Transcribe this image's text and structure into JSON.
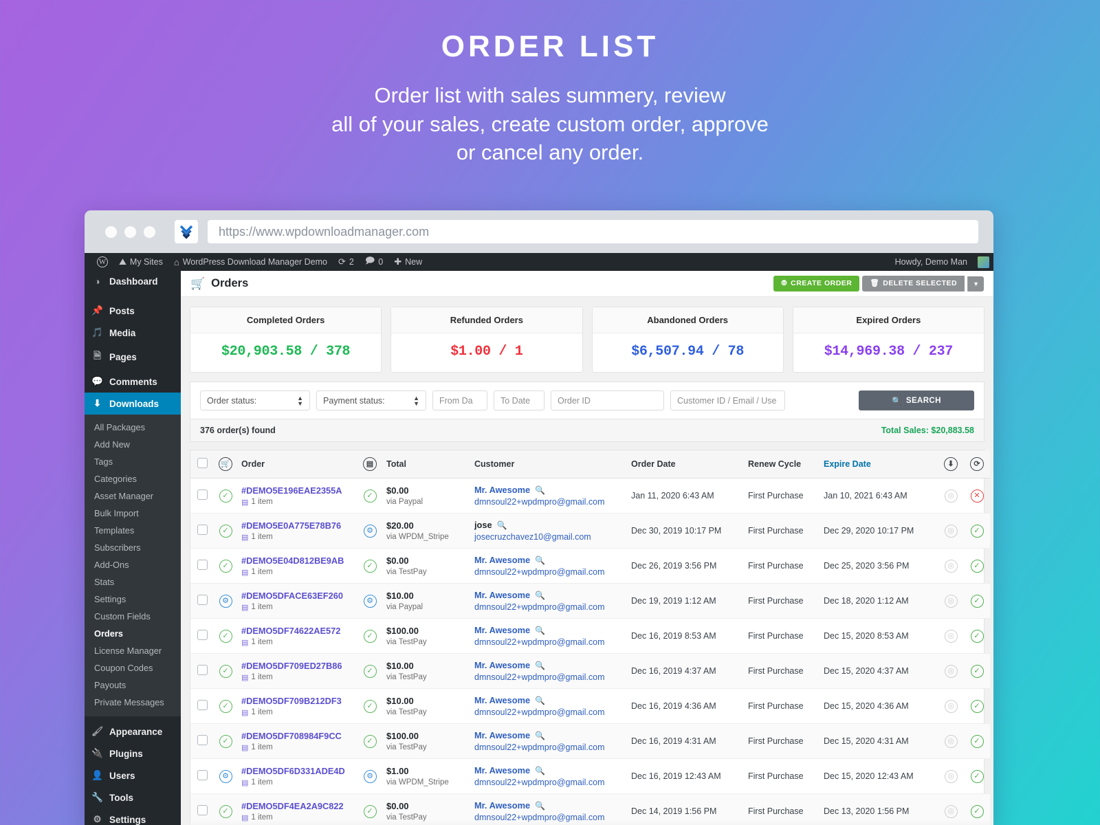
{
  "promo": {
    "title": "ORDER LIST",
    "subtitle_lines": [
      "Order list with sales summery, review",
      "all of your sales, create custom order, approve",
      "or cancel any order."
    ]
  },
  "browser": {
    "url": "https://www.wpdownloadmanager.com"
  },
  "wpbar": {
    "my_sites": "My Sites",
    "site_name": "WordPress Download Manager Demo",
    "updates_count": "2",
    "comments_count": "0",
    "new_label": "New",
    "howdy": "Howdy, Demo Man"
  },
  "sidebar": {
    "main": [
      {
        "label": "Dashboard",
        "icon": "dashboard-icon"
      },
      {
        "label": "Posts",
        "icon": "pin-icon"
      },
      {
        "label": "Media",
        "icon": "media-icon"
      },
      {
        "label": "Pages",
        "icon": "pages-icon"
      },
      {
        "label": "Comments",
        "icon": "comment-icon"
      },
      {
        "label": "Downloads",
        "icon": "download-icon"
      }
    ],
    "submenu": [
      "All Packages",
      "Add New",
      "Tags",
      "Categories",
      "Asset Manager",
      "Bulk Import",
      "Templates",
      "Subscribers",
      "Add-Ons",
      "Stats",
      "Settings",
      "Custom Fields",
      "Orders",
      "License Manager",
      "Coupon Codes",
      "Payouts",
      "Private Messages"
    ],
    "current_sub": "Orders",
    "bottom": [
      {
        "label": "Appearance",
        "icon": "brush-icon"
      },
      {
        "label": "Plugins",
        "icon": "plug-icon"
      },
      {
        "label": "Users",
        "icon": "user-icon"
      },
      {
        "label": "Tools",
        "icon": "wrench-icon"
      },
      {
        "label": "Settings",
        "icon": "settings-icon"
      }
    ]
  },
  "page": {
    "title": "Orders",
    "create_order": "CREATE ORDER",
    "delete_selected": "DELETE SELECTED"
  },
  "stats": [
    {
      "title": "Completed Orders",
      "value": "$20,903.58 / 378",
      "color": "#1db954"
    },
    {
      "title": "Refunded Orders",
      "value": "$1.00 / 1",
      "color": "#f0323c"
    },
    {
      "title": "Abandoned Orders",
      "value": "$6,507.94 / 78",
      "color": "#2f5fe0"
    },
    {
      "title": "Expired Orders",
      "value": "$14,969.38 / 237",
      "color": "#8a3ff0"
    }
  ],
  "filters": {
    "order_status": "Order status:",
    "payment_status": "Payment status:",
    "from_date_placeholder": "From Da",
    "to_date_placeholder": "To Date",
    "order_id_placeholder": "Order ID",
    "customer_placeholder": "Customer ID / Email / Use",
    "search_label": "SEARCH"
  },
  "summary": {
    "count_text": "376 order(s) found",
    "total_sales": "Total Sales: $20,883.58"
  },
  "table": {
    "headers": {
      "order": "Order",
      "total": "Total",
      "customer": "Customer",
      "order_date": "Order Date",
      "renew_cycle": "Renew Cycle",
      "expire_date": "Expire Date"
    },
    "rows": [
      {
        "order_status": "complete",
        "order_no": "#DEMO5E196EAE2355A",
        "items": "1 item",
        "pay_status": "complete",
        "total": "$0.00",
        "via": "via Paypal",
        "customer": "Mr. Awesome",
        "customer_link": true,
        "email": "dmnsoul22+wpdmpro@gmail.com",
        "order_date": "Jan 11, 2020 6:43 AM",
        "renew_cycle": "First Purchase",
        "expire_date": "Jan 10, 2021 6:43 AM",
        "action": "cancel"
      },
      {
        "order_status": "complete",
        "order_no": "#DEMO5E0A775E78B76",
        "items": "1 item",
        "pay_status": "pending",
        "total": "$20.00",
        "via": "via WPDM_Stripe",
        "customer": "jose",
        "customer_link": false,
        "email": "josecruzchavez10@gmail.com",
        "order_date": "Dec 30, 2019 10:17 PM",
        "renew_cycle": "First Purchase",
        "expire_date": "Dec 29, 2020 10:17 PM",
        "action": "approve"
      },
      {
        "order_status": "complete",
        "order_no": "#DEMO5E04D812BE9AB",
        "items": "1 item",
        "pay_status": "complete",
        "total": "$0.00",
        "via": "via TestPay",
        "customer": "Mr. Awesome",
        "customer_link": true,
        "email": "dmnsoul22+wpdmpro@gmail.com",
        "order_date": "Dec 26, 2019 3:56 PM",
        "renew_cycle": "First Purchase",
        "expire_date": "Dec 25, 2020 3:56 PM",
        "action": "approve"
      },
      {
        "order_status": "pending",
        "order_no": "#DEMO5DFACE63EF260",
        "items": "1 item",
        "pay_status": "pending",
        "total": "$10.00",
        "via": "via Paypal",
        "customer": "Mr. Awesome",
        "customer_link": true,
        "email": "dmnsoul22+wpdmpro@gmail.com",
        "order_date": "Dec 19, 2019 1:12 AM",
        "renew_cycle": "First Purchase",
        "expire_date": "Dec 18, 2020 1:12 AM",
        "action": "approve"
      },
      {
        "order_status": "complete",
        "order_no": "#DEMO5DF74622AE572",
        "items": "1 item",
        "pay_status": "complete",
        "total": "$100.00",
        "via": "via TestPay",
        "customer": "Mr. Awesome",
        "customer_link": true,
        "email": "dmnsoul22+wpdmpro@gmail.com",
        "order_date": "Dec 16, 2019 8:53 AM",
        "renew_cycle": "First Purchase",
        "expire_date": "Dec 15, 2020 8:53 AM",
        "action": "approve"
      },
      {
        "order_status": "complete",
        "order_no": "#DEMO5DF709ED27B86",
        "items": "1 item",
        "pay_status": "complete",
        "total": "$10.00",
        "via": "via TestPay",
        "customer": "Mr. Awesome",
        "customer_link": true,
        "email": "dmnsoul22+wpdmpro@gmail.com",
        "order_date": "Dec 16, 2019 4:37 AM",
        "renew_cycle": "First Purchase",
        "expire_date": "Dec 15, 2020 4:37 AM",
        "action": "approve"
      },
      {
        "order_status": "complete",
        "order_no": "#DEMO5DF709B212DF3",
        "items": "1 item",
        "pay_status": "complete",
        "total": "$10.00",
        "via": "via TestPay",
        "customer": "Mr. Awesome",
        "customer_link": true,
        "email": "dmnsoul22+wpdmpro@gmail.com",
        "order_date": "Dec 16, 2019 4:36 AM",
        "renew_cycle": "First Purchase",
        "expire_date": "Dec 15, 2020 4:36 AM",
        "action": "approve"
      },
      {
        "order_status": "complete",
        "order_no": "#DEMO5DF708984F9CC",
        "items": "1 item",
        "pay_status": "complete",
        "total": "$100.00",
        "via": "via TestPay",
        "customer": "Mr. Awesome",
        "customer_link": true,
        "email": "dmnsoul22+wpdmpro@gmail.com",
        "order_date": "Dec 16, 2019 4:31 AM",
        "renew_cycle": "First Purchase",
        "expire_date": "Dec 15, 2020 4:31 AM",
        "action": "approve"
      },
      {
        "order_status": "pending",
        "order_no": "#DEMO5DF6D331ADE4D",
        "items": "1 item",
        "pay_status": "pending",
        "total": "$1.00",
        "via": "via WPDM_Stripe",
        "customer": "Mr. Awesome",
        "customer_link": true,
        "email": "dmnsoul22+wpdmpro@gmail.com",
        "order_date": "Dec 16, 2019 12:43 AM",
        "renew_cycle": "First Purchase",
        "expire_date": "Dec 15, 2020 12:43 AM",
        "action": "approve"
      },
      {
        "order_status": "complete",
        "order_no": "#DEMO5DF4EA2A9C822",
        "items": "1 item",
        "pay_status": "complete",
        "total": "$0.00",
        "via": "via TestPay",
        "customer": "Mr. Awesome",
        "customer_link": true,
        "email": "dmnsoul22+wpdmpro@gmail.com",
        "order_date": "Dec 14, 2019 1:56 PM",
        "renew_cycle": "First Purchase",
        "expire_date": "Dec 13, 2020 1:56 PM",
        "action": "approve"
      }
    ]
  }
}
